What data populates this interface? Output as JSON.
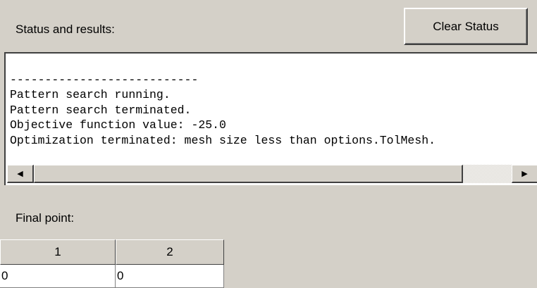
{
  "status": {
    "label": "Status and results:",
    "clear_button": "Clear Status",
    "lines": [
      "---------------------------",
      "Pattern search running.",
      "Pattern search terminated.",
      "Objective function value: -25.0",
      "Optimization terminated: mesh size less than options.TolMesh."
    ]
  },
  "final_point": {
    "label": "Final point:",
    "columns": [
      "1",
      "2"
    ],
    "values": [
      "0",
      "0"
    ]
  },
  "scrollbar": {
    "left_arrow": "◀",
    "right_arrow": "▶"
  }
}
